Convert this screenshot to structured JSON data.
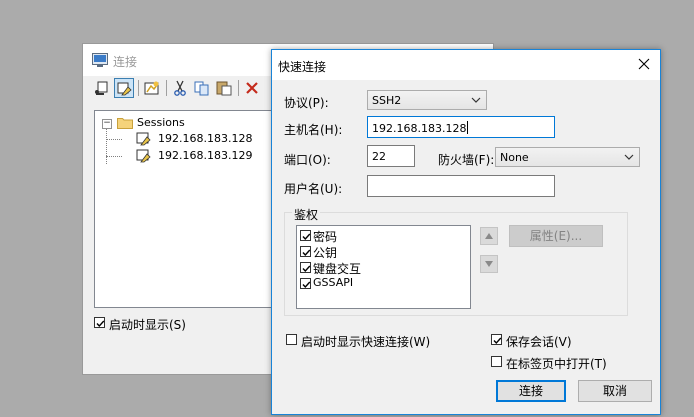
{
  "connect_window": {
    "title": "连接",
    "toolbar": [
      "quick-connect-icon",
      "connect-sessions-icon",
      "new-session-icon",
      "cut-icon",
      "copy-icon",
      "paste-icon",
      "delete-icon"
    ],
    "tree": {
      "root": "Sessions",
      "expander": "−",
      "sessions": [
        "192.168.183.128",
        "192.168.183.129"
      ]
    },
    "show_on_startup": {
      "label": "启动时显示(S)",
      "checked": true
    }
  },
  "quick_connect": {
    "title": "快速连接",
    "protocol": {
      "label": "协议(P):",
      "value": "SSH2"
    },
    "hostname": {
      "label": "主机名(H):",
      "value": "192.168.183.128"
    },
    "port": {
      "label": "端口(O):",
      "value": "22"
    },
    "firewall": {
      "label": "防火墙(F):",
      "value": "None"
    },
    "username": {
      "label": "用户名(U):",
      "value": ""
    },
    "auth": {
      "label": "鉴权",
      "methods": [
        {
          "label": "密码",
          "checked": true
        },
        {
          "label": "公钥",
          "checked": true
        },
        {
          "label": "键盘交互",
          "checked": true
        },
        {
          "label": "GSSAPI",
          "checked": true
        }
      ],
      "properties_button": "属性(E)..."
    },
    "show_quick_connect_on_startup": {
      "label": "启动时显示快速连接(W)",
      "checked": false
    },
    "save_session": {
      "label": "保存会话(V)",
      "checked": true
    },
    "open_in_tab": {
      "label": "在标签页中打开(T)",
      "checked": false
    },
    "connect_button": "连接",
    "cancel_button": "取消"
  },
  "colors": {
    "focus": "#0078d7",
    "background": "#ababab",
    "dialog": "#f0f0f0"
  }
}
